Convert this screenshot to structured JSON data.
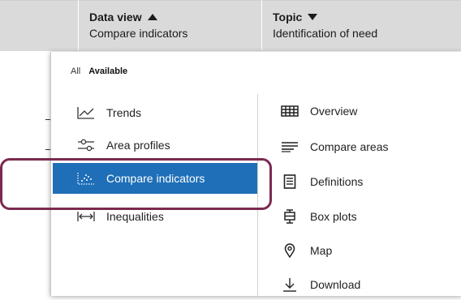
{
  "header": {
    "data_view": {
      "title": "Data view",
      "value": "Compare indicators"
    },
    "topic": {
      "title": "Topic",
      "value": "Identification of need"
    }
  },
  "filters": {
    "all": "All",
    "available": "Available"
  },
  "left_menu": [
    {
      "label": "Trends",
      "icon": "trend-line-icon"
    },
    {
      "label": "Area profiles",
      "icon": "sliders-icon"
    },
    {
      "label": "Compare indicators",
      "icon": "scatter-icon",
      "selected": true
    },
    {
      "label": "Inequalities",
      "icon": "double-arrow-icon"
    }
  ],
  "right_menu": [
    {
      "label": "Overview",
      "icon": "grid-table-icon"
    },
    {
      "label": "Compare areas",
      "icon": "bars-lines-icon"
    },
    {
      "label": "Definitions",
      "icon": "document-icon"
    },
    {
      "label": "Box plots",
      "icon": "box-plot-icon"
    },
    {
      "label": "Map",
      "icon": "map-pin-icon"
    },
    {
      "label": "Download",
      "icon": "download-icon"
    }
  ],
  "colors": {
    "selected_bg": "#1f6fb8",
    "highlight_border": "#7b2a4f",
    "header_bg": "#dadada"
  }
}
